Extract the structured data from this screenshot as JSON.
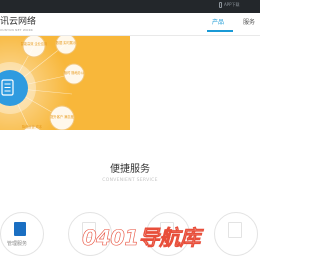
{
  "topbar": {
    "app_link": "APP下载"
  },
  "header": {
    "logo_title": "讯云网络",
    "logo_subtitle": "XUNYUN NET WORK",
    "nav": [
      {
        "label": "产品"
      },
      {
        "label": "服务"
      }
    ]
  },
  "hero": {
    "bubbles": [
      {
        "label": "智能高效 企业应用"
      },
      {
        "label": "数据 实时展示"
      },
      {
        "label": "随时 随地办公"
      },
      {
        "label": "提升客户 满意度"
      },
      {
        "label": "降低运营 成本"
      }
    ],
    "colors": {
      "background": "#f8b73a",
      "center": "#2f9be0"
    }
  },
  "section": {
    "title": "便捷服务",
    "subtitle": "CONVENIENT SERVICE"
  },
  "features": [
    {
      "label": "管理服务"
    },
    {
      "label": ""
    },
    {
      "label": ""
    },
    {
      "label": ""
    }
  ],
  "watermark": {
    "text": "0401导航库"
  }
}
